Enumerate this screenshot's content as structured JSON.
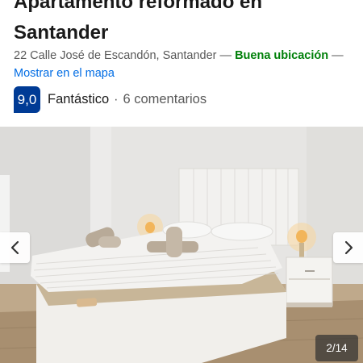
{
  "listing": {
    "title": "Apartamento reformado en Santander",
    "address": "22 Calle José de Escandón, Santander",
    "separator_1": " — ",
    "location_badge": "Buena ubicación",
    "separator_2": " —",
    "map_link": "Mostrar en el mapa"
  },
  "rating": {
    "score": "9,0",
    "label": "Fantástico",
    "separator": "·",
    "reviews": "6 comentarios"
  },
  "gallery": {
    "counter": "2/14",
    "prev_icon": "chevron-left-icon",
    "next_icon": "chevron-right-icon"
  },
  "colors": {
    "score_bg": "#003b95",
    "good_location": "#008009",
    "link": "#006ce4"
  }
}
